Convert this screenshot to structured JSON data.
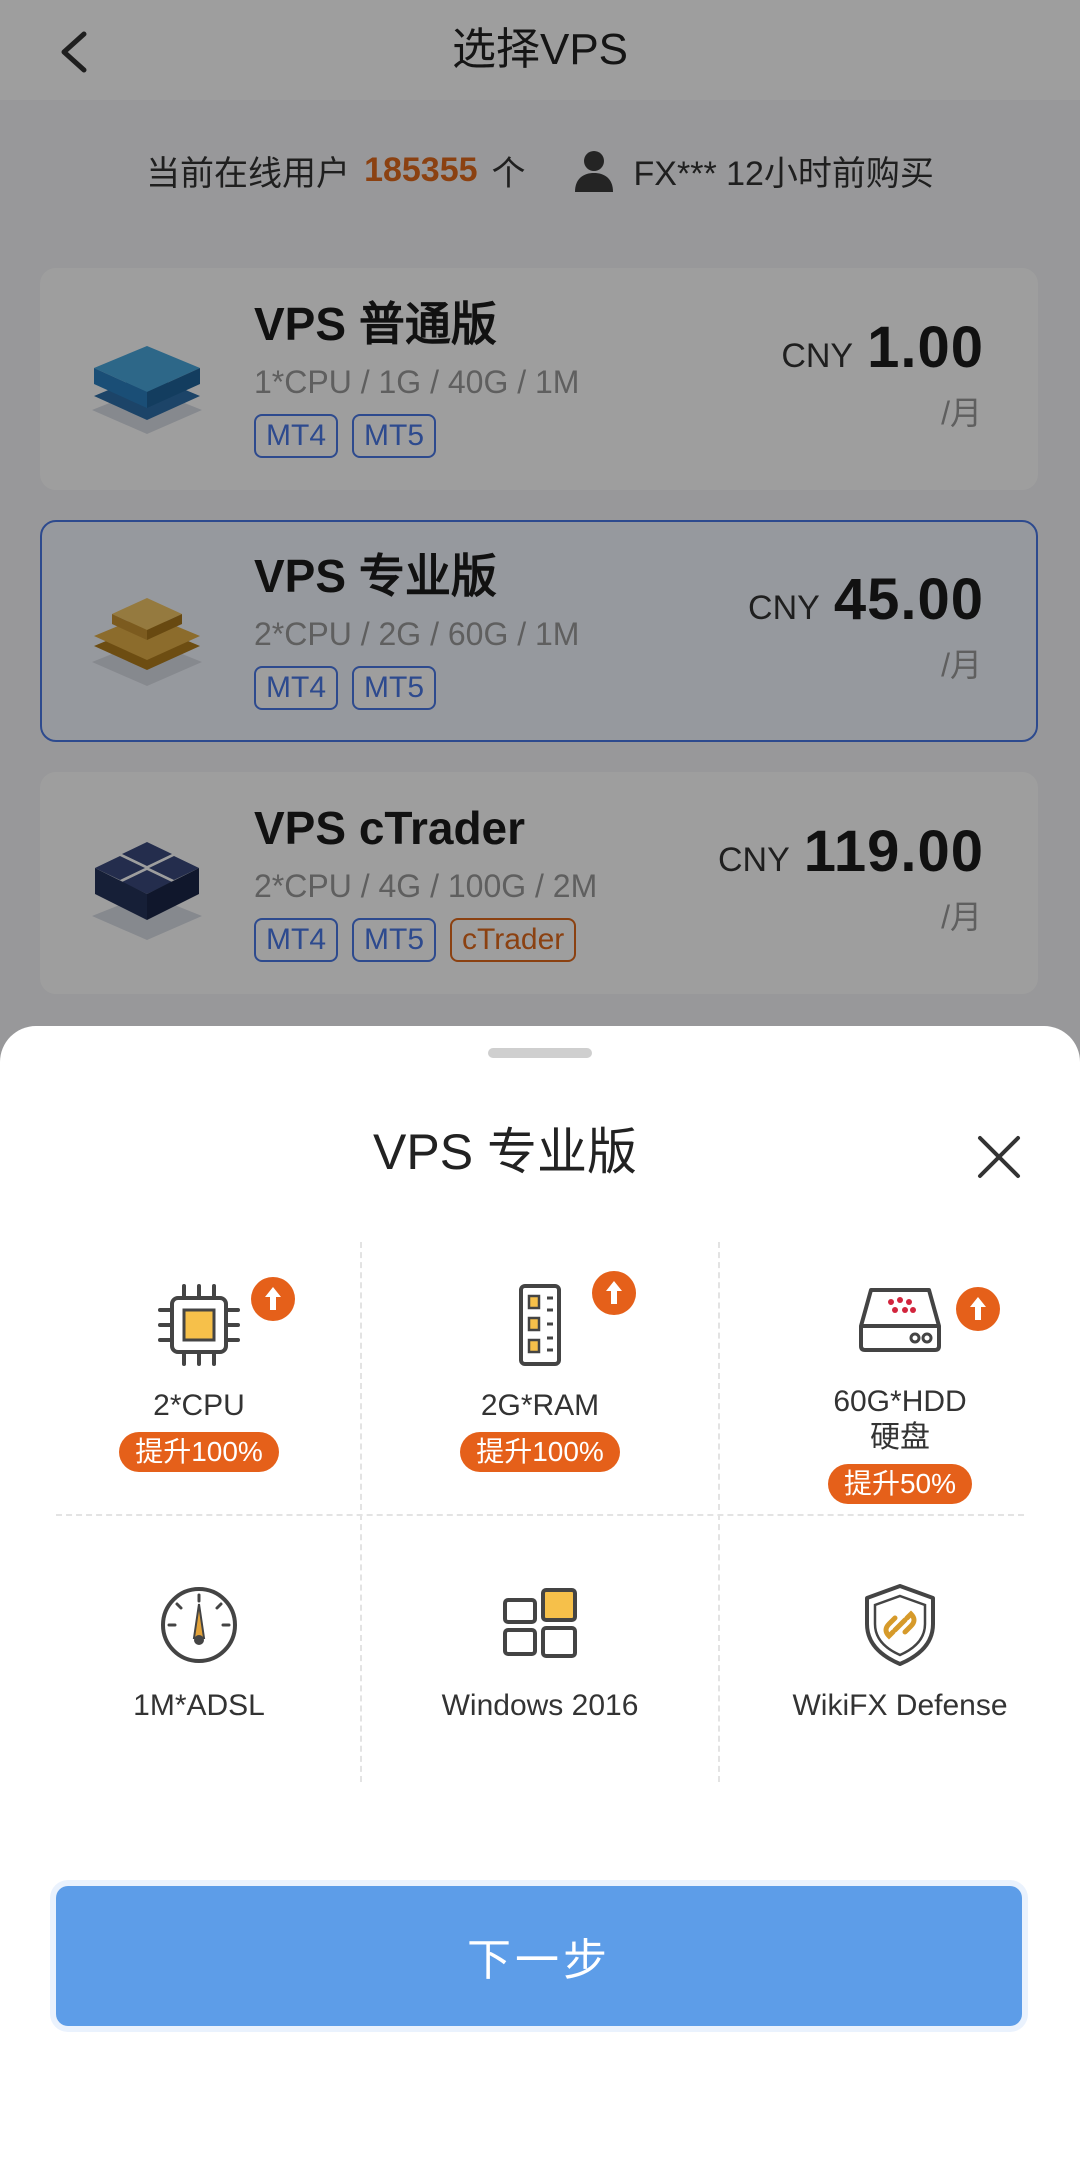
{
  "header": {
    "title": "选择VPS"
  },
  "online": {
    "prefix": "当前在线用户",
    "count": "185355",
    "suffix": "个",
    "buyer": "FX*** 12小时前购买"
  },
  "plans": [
    {
      "name": "VPS 普通版",
      "spec": "1*CPU / 1G / 40G / 1M",
      "tags": [
        "MT4",
        "MT5"
      ],
      "currency": "CNY",
      "price": "1.00",
      "unit": "/月",
      "color": "#3a8fd0"
    },
    {
      "name": "VPS 专业版",
      "spec": "2*CPU / 2G / 60G / 1M",
      "tags": [
        "MT4",
        "MT5"
      ],
      "currency": "CNY",
      "price": "45.00",
      "unit": "/月",
      "color": "#d6a23a"
    },
    {
      "name": "VPS cTrader",
      "spec": "2*CPU / 4G / 100G / 2M",
      "tags": [
        "MT4",
        "MT5",
        "cTrader"
      ],
      "currency": "CNY",
      "price": "119.00",
      "unit": "/月",
      "color": "#2c3a66"
    }
  ],
  "sheet": {
    "title": "VPS 专业版",
    "features": [
      {
        "icon": "cpu-icon",
        "label": "2*CPU",
        "badge": "提升100%"
      },
      {
        "icon": "ram-icon",
        "label": "2G*RAM",
        "badge": "提升100%"
      },
      {
        "icon": "hdd-icon",
        "label": "60G*HDD",
        "label2": "硬盘",
        "badge": "提升50%"
      },
      {
        "icon": "speedometer-icon",
        "label": "1M*ADSL"
      },
      {
        "icon": "windows-icon",
        "label": "Windows 2016"
      },
      {
        "icon": "shield-icon",
        "label": "WikiFX Defense"
      }
    ],
    "next_label": "下一步"
  },
  "colors": {
    "accent": "#e5601a",
    "primary": "#5d9de8",
    "tag_blue": "#4a78e6"
  }
}
